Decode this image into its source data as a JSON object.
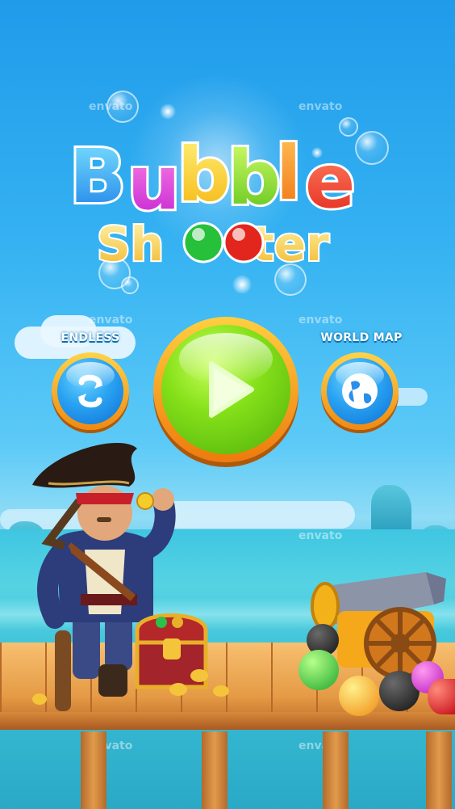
{
  "logo": {
    "line1": "Bubble",
    "line2": "Shooter"
  },
  "watermark": "envato",
  "menu": {
    "endless": {
      "label": "ENDLESS",
      "icon": "shuffle-icon"
    },
    "play": {
      "icon": "play-icon"
    },
    "world_map": {
      "label": "WORLD MAP",
      "icon": "globe-icon"
    }
  },
  "colors": {
    "sky": "#2aa6ee",
    "play_button": "#7ad61a",
    "side_button": "#2aa3f2",
    "button_ring": "#f7a21f",
    "dock": "#e9a04f"
  },
  "scene": {
    "characters": [
      "pirate-captain"
    ],
    "props": [
      "treasure-chest",
      "gold-coins",
      "cannon",
      "colored-bubbles"
    ]
  }
}
